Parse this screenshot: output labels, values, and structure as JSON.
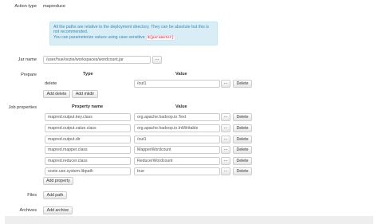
{
  "action": {
    "type_label": "Action type",
    "type_value": "mapreduce"
  },
  "alert": {
    "line1": "All the paths are relative to the deployment directory. They can be absolute but this is",
    "line2": "not recommended.",
    "line3": "You can parameterize values using case sensitive",
    "code": "${parameter}"
  },
  "jar": {
    "label": "Jar name",
    "value": "/user/hue/oozie/workspaces/wordcount.jar",
    "browse": "..."
  },
  "prepare": {
    "label": "Prepare",
    "col_type": "Type",
    "col_value": "Value",
    "rows": [
      {
        "type": "delete",
        "value": "/out1",
        "browse": "...",
        "delete": "Delete"
      }
    ],
    "add_delete": "Add delete",
    "add_mkdir": "Add mkdir"
  },
  "job_properties": {
    "label": "Job properties",
    "col_name": "Property name",
    "col_value": "Value",
    "rows": [
      {
        "name": "mapred.output.key.class",
        "value": "org.apache.hadoop.io.Text",
        "browse": "...",
        "delete": "Delete"
      },
      {
        "name": "mapred.output.value.class",
        "value": "org.apache.hadoop.io.IntWritable",
        "browse": "...",
        "delete": "Delete"
      },
      {
        "name": "mapred.output.dir",
        "value": "/out1",
        "browse": "...",
        "delete": "Delete"
      },
      {
        "name": "mapred.mapper.class",
        "value": "MapperWordcount",
        "browse": "...",
        "delete": "Delete"
      },
      {
        "name": "mapred.reducer.class",
        "value": "ReducerWordcount",
        "browse": "...",
        "delete": "Delete"
      },
      {
        "name": "oozie.use.system.libpath",
        "value": "true",
        "browse": "...",
        "delete": "Delete"
      }
    ],
    "add_property": "Add property"
  },
  "files": {
    "label": "Files",
    "add_path": "Add path"
  },
  "archives": {
    "label": "Archives",
    "add_archive": "Add archive"
  }
}
